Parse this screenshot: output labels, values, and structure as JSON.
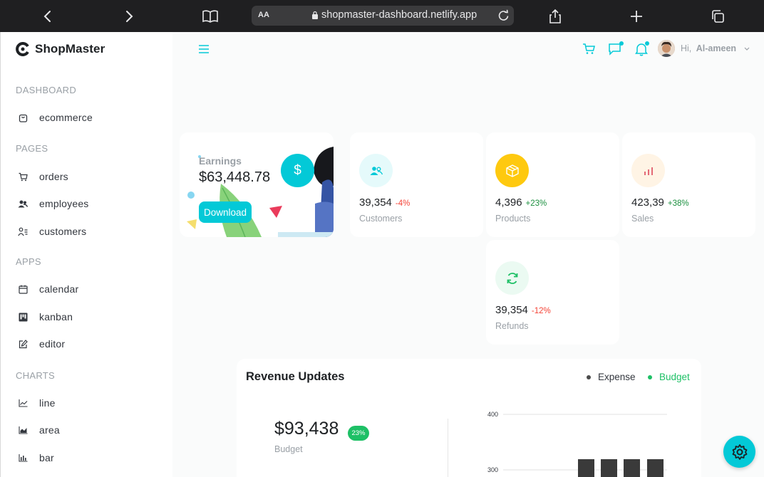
{
  "browser": {
    "url_aa": "AA",
    "url": "shopmaster-dashboard.netlify.app"
  },
  "sidebar": {
    "brand": "ShopMaster",
    "sections": [
      {
        "title": "DASHBOARD",
        "items": [
          {
            "label": "ecommerce",
            "icon": "shopping-bag-icon"
          }
        ]
      },
      {
        "title": "PAGES",
        "items": [
          {
            "label": "orders",
            "icon": "cart-icon"
          },
          {
            "label": "employees",
            "icon": "employees-icon"
          },
          {
            "label": "customers",
            "icon": "customers-icon"
          }
        ]
      },
      {
        "title": "APPS",
        "items": [
          {
            "label": "calendar",
            "icon": "calendar-icon"
          },
          {
            "label": "kanban",
            "icon": "kanban-icon"
          },
          {
            "label": "editor",
            "icon": "edit-icon"
          }
        ]
      },
      {
        "title": "CHARTS",
        "items": [
          {
            "label": "line",
            "icon": "line-chart-icon"
          },
          {
            "label": "area",
            "icon": "area-chart-icon"
          },
          {
            "label": "bar",
            "icon": "bar-chart-icon"
          }
        ]
      }
    ]
  },
  "navbar": {
    "greeting": "Hi,",
    "user": "Al-ameen"
  },
  "earnings": {
    "label": "Earnings",
    "value": "$63,448.78",
    "button": "Download",
    "icon_symbol": "$"
  },
  "stats": [
    {
      "value": "39,354",
      "change": "-4%",
      "label": "Customers",
      "icon": "customers-icon",
      "icon_color": "#03c9d7",
      "icon_bg": "#e5fafb",
      "change_color": "#f44336"
    },
    {
      "value": "4,396",
      "change": "+23%",
      "label": "Products",
      "icon": "box-icon",
      "icon_color": "#ffffff",
      "icon_bg": "#fec90f",
      "change_color": "#1a8f3e"
    },
    {
      "value": "423,39",
      "change": "+38%",
      "label": "Sales",
      "icon": "bar-chart-icon",
      "icon_color": "#e46a76",
      "icon_bg": "#fff4e5",
      "change_color": "#1a8f3e"
    },
    {
      "value": "39,354",
      "change": "-12%",
      "label": "Refunds",
      "icon": "refresh-icon",
      "icon_color": "#1ec066",
      "icon_bg": "#ebfaf2",
      "change_color": "#f44336"
    }
  ],
  "revenue": {
    "title": "Revenue Updates",
    "legend": [
      {
        "label": "Expense",
        "color": "#4b4b4b"
      },
      {
        "label": "Budget",
        "color": "#1ec066"
      }
    ],
    "budget_value": "$93,438",
    "budget_badge": "23%",
    "budget_label": "Budget",
    "chart": {
      "y_ticks": [
        "400",
        "300"
      ]
    }
  },
  "colors": {
    "accent": "#03c9d7"
  }
}
